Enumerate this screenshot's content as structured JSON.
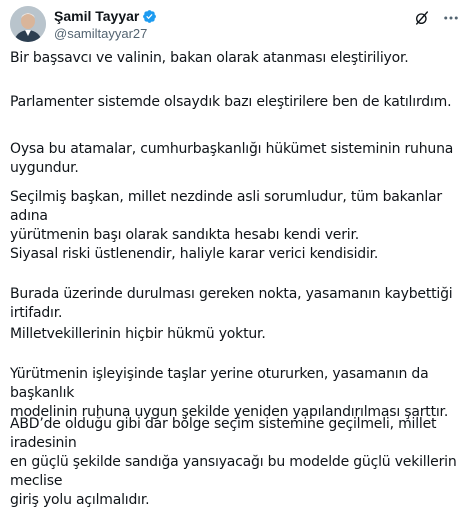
{
  "author": {
    "display_name": "Şamil Tayyar",
    "handle": "@samiltayyar27",
    "verified": true,
    "verified_color": "#1d9bf0"
  },
  "actions": {
    "grok_icon": "grok-slash-icon",
    "more_icon": "more-horizontal-icon"
  },
  "paragraphs": [
    "Bir başsavcı ve valinin, bakan olarak atanması eleştiriliyor.",
    "Parlamenter sistemde olsaydık bazı eleştirilere ben de katılırdım.",
    "Oysa bu atamalar, cumhurbaşkanlığı hükümet sisteminin ruhuna\nuygundur.",
    "Seçilmiş başkan, millet nezdinde asli sorumludur, tüm bakanlar adına\nyürütmenin başı olarak sandıkta hesabı kendi verir.",
    "Siyasal riski üstlenendir, haliyle karar verici kendisidir.",
    "Burada üzerinde durulması gereken nokta, yasamanın kaybettiği irtifadır.",
    "Milletvekillerinin hiçbir hükmü yoktur.",
    "Yürütmenin işleyişinde taşlar yerine otururken, yasamanın da başkanlık\nmodelinin ruhuna uygun şekilde yeniden yapılandırılması şarttır.",
    "ABD’de olduğu gibi dar bölge seçim sistemine geçilmeli, millet iradesinin\nen güçlü şekilde sandığa yansıyacağı bu modelde güçlü vekillerin meclise\ngiriş yolu açılmalıdır."
  ]
}
